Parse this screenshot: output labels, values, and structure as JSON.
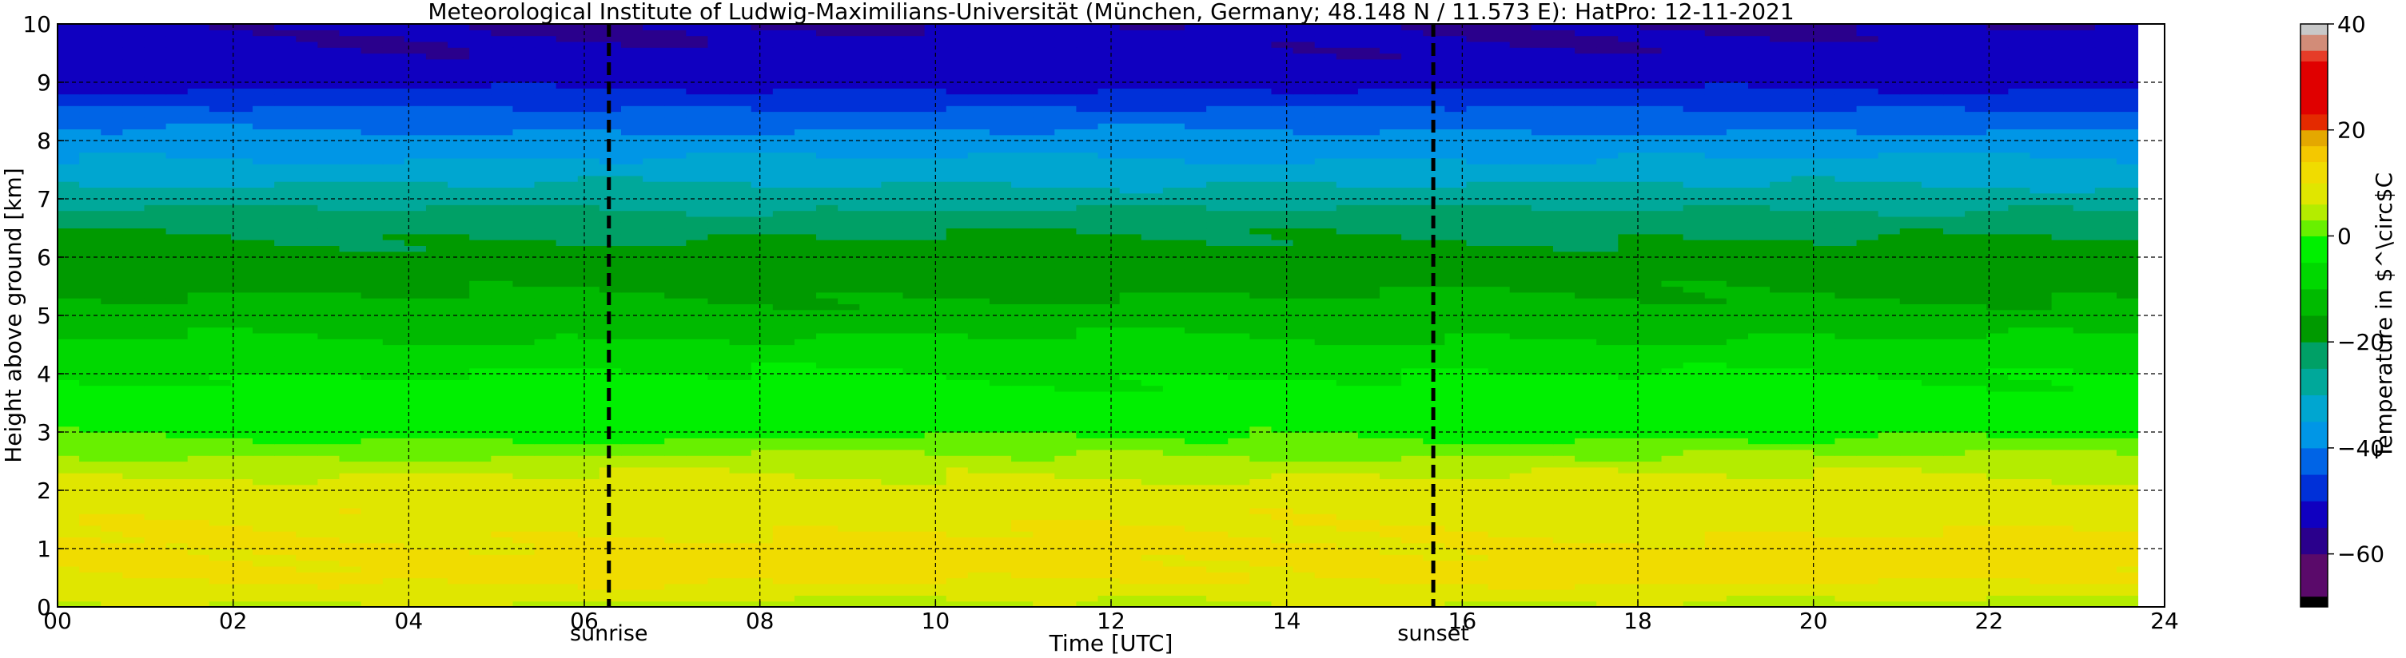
{
  "chart_data": {
    "type": "heatmap",
    "title": "Meteorological Institute of Ludwig-Maximilians-Universität (München, Germany; 48.148 N / 11.573 E):    HatPro: 12-11-2021",
    "xlabel": "Time [UTC]",
    "ylabel": "Height above ground [km]",
    "xlim": [
      0,
      24
    ],
    "ylim": [
      0,
      10
    ],
    "x_ticks": [
      "00",
      "02",
      "04",
      "06",
      "08",
      "10",
      "12",
      "14",
      "16",
      "18",
      "20",
      "22",
      "24"
    ],
    "y_ticks": [
      "0",
      "1",
      "2",
      "3",
      "4",
      "5",
      "6",
      "7",
      "8",
      "9",
      "10"
    ],
    "grid": true,
    "data_end_hour": 23.7,
    "vertical_markers": [
      {
        "label": "sunrise",
        "x": 6.28
      },
      {
        "label": "sunset",
        "x": 15.67
      }
    ],
    "colorbar": {
      "label": "Temperature in $^\\circ$C",
      "tick_labels": [
        "40",
        "20",
        "0",
        "−20",
        "−40",
        "−60"
      ],
      "range": [
        -70,
        40
      ],
      "steps": [
        {
          "from": -70,
          "to": -68,
          "color": "#000000"
        },
        {
          "from": -68,
          "to": -60,
          "color": "#5a0a6a"
        },
        {
          "from": -60,
          "to": -55,
          "color": "#2a008c"
        },
        {
          "from": -55,
          "to": -50,
          "color": "#1000c0"
        },
        {
          "from": -50,
          "to": -45,
          "color": "#0030d8"
        },
        {
          "from": -45,
          "to": -40,
          "color": "#0064e6"
        },
        {
          "from": -40,
          "to": -35,
          "color": "#0096e6"
        },
        {
          "from": -35,
          "to": -30,
          "color": "#00a6d0"
        },
        {
          "from": -30,
          "to": -25,
          "color": "#00a89a"
        },
        {
          "from": -25,
          "to": -20,
          "color": "#00a066"
        },
        {
          "from": -20,
          "to": -15,
          "color": "#009a00"
        },
        {
          "from": -15,
          "to": -10,
          "color": "#00ba00"
        },
        {
          "from": -10,
          "to": -5,
          "color": "#00d800"
        },
        {
          "from": -5,
          "to": 0,
          "color": "#00f000"
        },
        {
          "from": 0,
          "to": 3,
          "color": "#68f000"
        },
        {
          "from": 3,
          "to": 6,
          "color": "#b4ec00"
        },
        {
          "from": 6,
          "to": 10,
          "color": "#e0e600"
        },
        {
          "from": 10,
          "to": 14,
          "color": "#f0dc00"
        },
        {
          "from": 14,
          "to": 17,
          "color": "#f4c800"
        },
        {
          "from": 17,
          "to": 20,
          "color": "#e4a800"
        },
        {
          "from": 20,
          "to": 23,
          "color": "#e42a00"
        },
        {
          "from": 23,
          "to": 33,
          "color": "#e00000"
        },
        {
          "from": 33,
          "to": 35,
          "color": "#e63c28"
        },
        {
          "from": 35,
          "to": 38,
          "color": "#d28c78"
        },
        {
          "from": 38,
          "to": 40,
          "color": "#c8c8c8"
        }
      ]
    },
    "temperature_profile": {
      "heights_km": [
        0.0,
        0.2,
        0.5,
        1.0,
        1.5,
        2.0,
        2.5,
        3.0,
        3.5,
        4.0,
        4.5,
        5.0,
        5.5,
        6.0,
        6.5,
        7.0,
        7.5,
        8.0,
        8.5,
        9.0,
        9.5,
        10.0
      ],
      "temperature_c": [
        5,
        7,
        11,
        11,
        9,
        8,
        4,
        -1,
        -3,
        -5,
        -9,
        -13,
        -16,
        -18,
        -21,
        -27,
        -33,
        -38,
        -44,
        -52,
        -54,
        -55
      ]
    }
  }
}
